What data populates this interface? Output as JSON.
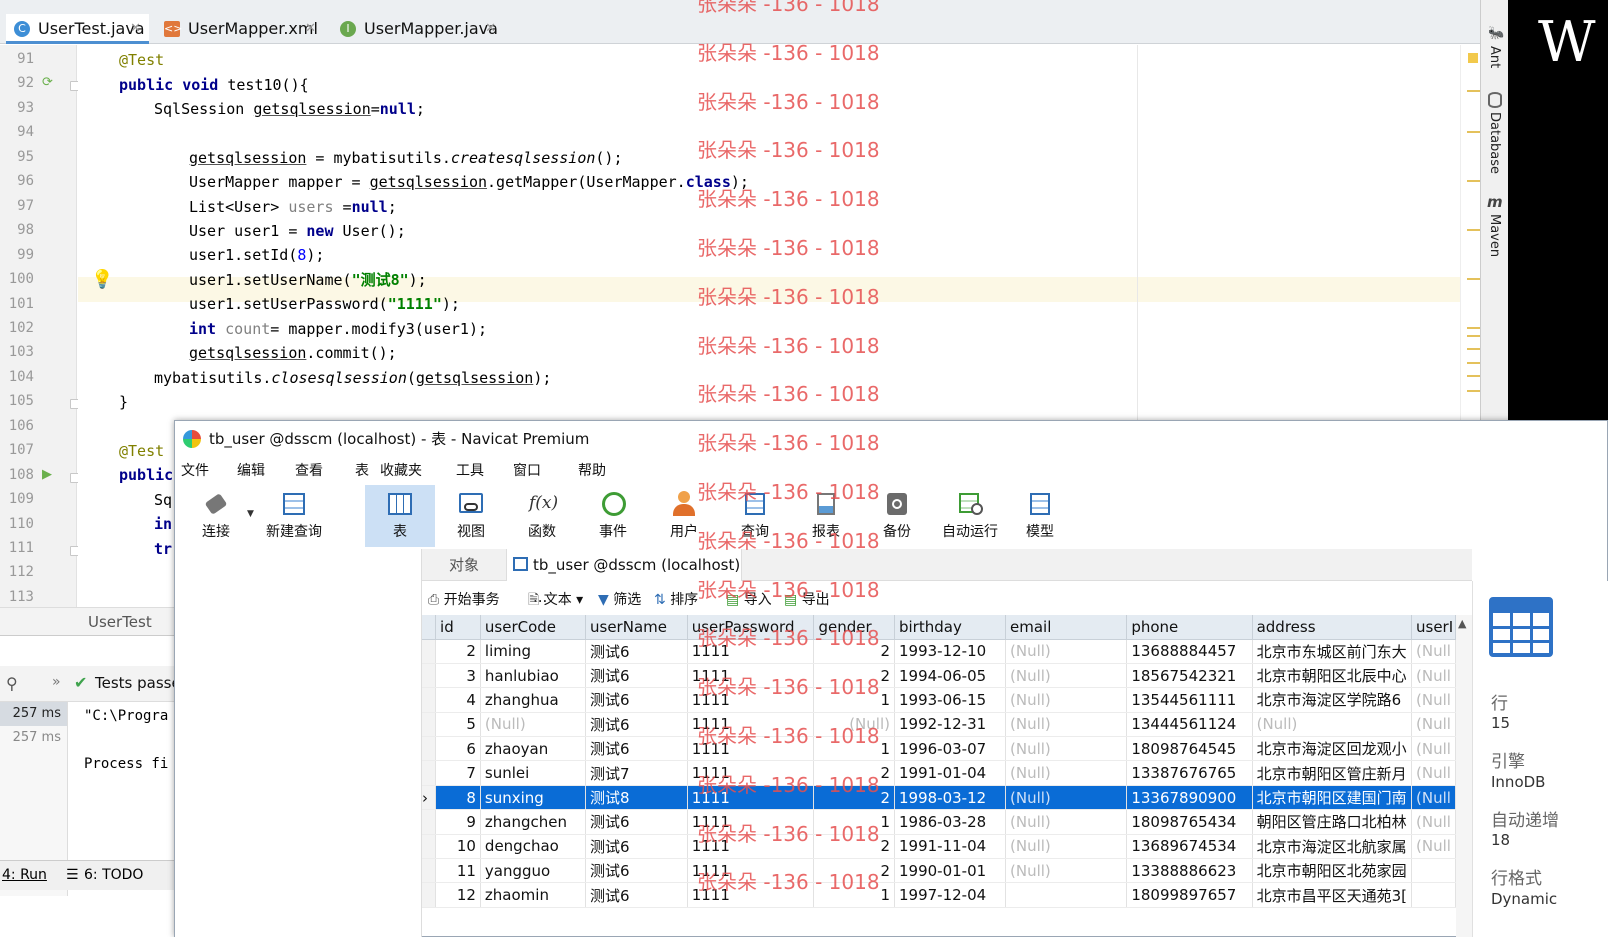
{
  "ide": {
    "tabs": [
      {
        "label": "UserTest.java",
        "icon": "class-icon",
        "active": true
      },
      {
        "label": "UserMapper.xml",
        "icon": "xml-icon",
        "active": false
      },
      {
        "label": "UserMapper.java",
        "icon": "interface-icon",
        "active": false
      }
    ],
    "line_numbers": [
      "91",
      "92",
      "93",
      "94",
      "95",
      "96",
      "97",
      "98",
      "99",
      "100",
      "101",
      "102",
      "103",
      "104",
      "105",
      "106",
      "107",
      "108",
      "109",
      "110",
      "111",
      "112",
      "113"
    ],
    "code_lines": [
      {
        "t": "@Test"
      },
      {
        "t": "public void test10(){"
      },
      {
        "t": "SqlSession getsqlsession=null;"
      },
      {
        "t": ""
      },
      {
        "t": "getsqlsession = mybatisutils.createsqlsession();"
      },
      {
        "t": "UserMapper mapper = getsqlsession.getMapper(UserMapper.class);"
      },
      {
        "t": "List<User> users =null;"
      },
      {
        "t": "User user1 = new User();"
      },
      {
        "t": "user1.setId(8);"
      },
      {
        "t": "user1.setUserName(\"测试8\");"
      },
      {
        "t": "user1.setUserPassword(\"1111\");"
      },
      {
        "t": "int count= mapper.modify3(user1);"
      },
      {
        "t": "getsqlsession.commit();"
      },
      {
        "t": "mybatisutils.closesqlsession(getsqlsession);"
      },
      {
        "t": "}"
      },
      {
        "t": ""
      },
      {
        "t": "@Test"
      },
      {
        "t": "public"
      },
      {
        "t": "Sq"
      },
      {
        "t": "in"
      },
      {
        "t": "tr"
      },
      {
        "t": ""
      },
      {
        "t": ""
      }
    ],
    "right_tools": [
      "Ant",
      "Database",
      "Maven"
    ],
    "black_glyph": "W",
    "breadcrumb": "UserTest",
    "run": {
      "header_text": "Tests passe",
      "times": [
        "257 ms",
        "257 ms"
      ],
      "output": [
        "\"C:\\Progra",
        "Process fi"
      ]
    },
    "bottom_tabs": [
      "4: Run",
      "6: TODO"
    ]
  },
  "navicat": {
    "title": "tb_user @dsscm (localhost) - 表 - Navicat Premium",
    "menu": [
      "文件",
      "编辑",
      "查看",
      "收藏夹",
      "工具",
      "窗口",
      "帮助"
    ],
    "menu_prefix": "表",
    "toolbar": [
      {
        "label": "连接",
        "icon": "connection-icon"
      },
      {
        "label": "新建查询",
        "icon": "new-query-icon"
      },
      {
        "label": "表",
        "icon": "table-icon",
        "active": true
      },
      {
        "label": "视图",
        "icon": "view-icon"
      },
      {
        "label": "函数",
        "icon": "function-icon"
      },
      {
        "label": "事件",
        "icon": "event-icon"
      },
      {
        "label": "用户",
        "icon": "user-icon"
      },
      {
        "label": "查询",
        "icon": "query-icon"
      },
      {
        "label": "报表",
        "icon": "report-icon"
      },
      {
        "label": "备份",
        "icon": "backup-icon"
      },
      {
        "label": "自动运行",
        "icon": "auto-run-icon"
      },
      {
        "label": "模型",
        "icon": "model-icon"
      }
    ],
    "function_symbol": "f(x)",
    "tabs": [
      "对象",
      "tb_user @dsscm (localhost) ..."
    ],
    "subtoolbar": [
      "开始事务",
      "文本",
      "筛选",
      "排序",
      "导入",
      "导出"
    ],
    "columns": [
      "id",
      "userCode",
      "userName",
      "userPassword",
      "gender",
      "birthday",
      "email",
      "phone",
      "address",
      "userI"
    ],
    "rows": [
      [
        "2",
        "liming",
        "测试6",
        "1111",
        "2",
        "1993-12-10",
        "(Null)",
        "13688884457",
        "北京市东城区前门东大",
        "(Null"
      ],
      [
        "3",
        "hanlubiao",
        "测试6",
        "1111",
        "2",
        "1994-06-05",
        "(Null)",
        "18567542321",
        "北京市朝阳区北辰中心",
        "(Null"
      ],
      [
        "4",
        "zhanghua",
        "测试6",
        "1111",
        "1",
        "1993-06-15",
        "(Null)",
        "13544561111",
        "北京市海淀区学院路6",
        "(Null"
      ],
      [
        "5",
        "(Null)",
        "测试6",
        "1111",
        "(Null)",
        "1992-12-31",
        "(Null)",
        "13444561124",
        "(Null)",
        "(Null"
      ],
      [
        "6",
        "zhaoyan",
        "测试6",
        "1111",
        "1",
        "1996-03-07",
        "(Null)",
        "18098764545",
        "北京市海淀区回龙观小",
        "(Null"
      ],
      [
        "7",
        "sunlei",
        "测试7",
        "1111",
        "2",
        "1991-01-04",
        "(Null)",
        "13387676765",
        "北京市朝阳区管庄新月",
        "(Null"
      ],
      [
        "8",
        "sunxing",
        "测试8",
        "1111",
        "2",
        "1998-03-12",
        "(Null)",
        "13367890900",
        "北京市朝阳区建国门南",
        "(Null"
      ],
      [
        "9",
        "zhangchen",
        "测试6",
        "1111",
        "1",
        "1986-03-28",
        "(Null)",
        "18098765434",
        "朝阳区管庄路口北柏林",
        "(Null"
      ],
      [
        "10",
        "dengchao",
        "测试6",
        "1111",
        "2",
        "1991-11-04",
        "(Null)",
        "13689674534",
        "北京市海淀区北航家属",
        "(Null"
      ],
      [
        "11",
        "yangguo",
        "测试6",
        "1111",
        "2",
        "1990-01-01",
        "(Null)",
        "13388886623",
        "北京市朝阳区北苑家园",
        ""
      ],
      [
        "12",
        "zhaomin",
        "测试6",
        "1111",
        "1",
        "1997-12-04",
        "",
        "18099897657",
        "北京市昌平区天通苑3[",
        ""
      ]
    ],
    "selected_row_index": 6,
    "info": [
      {
        "label": "行",
        "value": "15"
      },
      {
        "label": "引擎",
        "value": "InnoDB"
      },
      {
        "label": "自动递增",
        "value": "18"
      },
      {
        "label": "行格式",
        "value": "Dynamic"
      }
    ]
  },
  "watermark": "张朵朵 -136 - 1018",
  "colors": {
    "selection": "#0a6cd6",
    "accent": "#4d8fd1",
    "watermark": "#e65050"
  }
}
